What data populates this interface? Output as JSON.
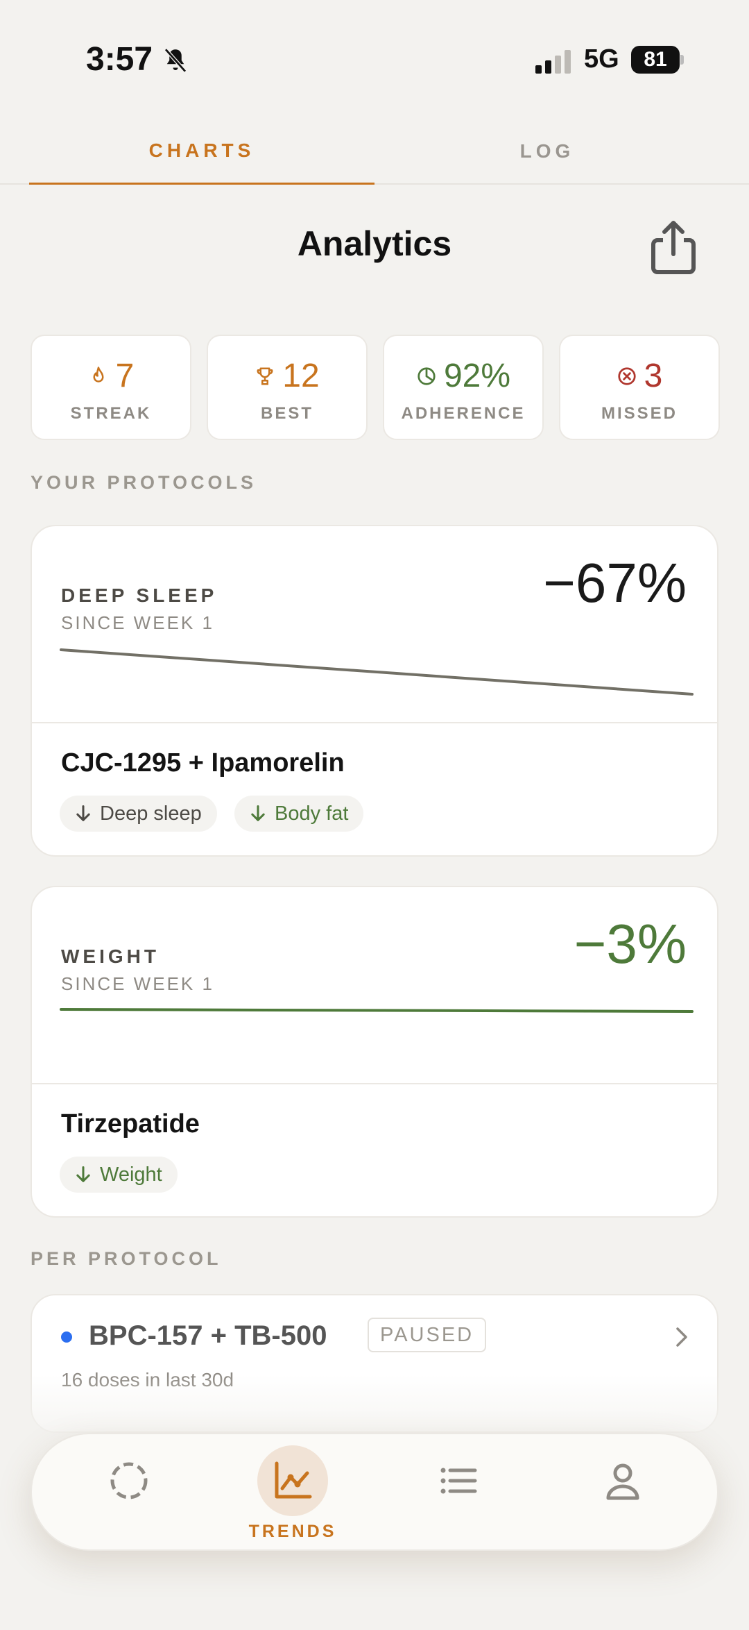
{
  "status": {
    "time": "3:57",
    "network": "5G",
    "battery": "81"
  },
  "tabs": [
    {
      "label": "CHARTS"
    },
    {
      "label": "LOG"
    }
  ],
  "header": {
    "title": "Analytics"
  },
  "stats": [
    {
      "value": "7",
      "label": "STREAK",
      "icon": "flame-icon",
      "color": "#c8741e"
    },
    {
      "value": "12",
      "label": "BEST",
      "icon": "trophy-icon",
      "color": "#c8741e"
    },
    {
      "value": "92%",
      "label": "ADHERENCE",
      "icon": "pie-icon",
      "color": "#4e7a3a"
    },
    {
      "value": "3",
      "label": "MISSED",
      "icon": "x-circle-icon",
      "color": "#b0372e"
    }
  ],
  "section_protocols": "YOUR PROTOCOLS",
  "protocol_cards": [
    {
      "metric": "DEEP SLEEP",
      "since": "SINCE WEEK 1",
      "change": "−67%",
      "name": "CJC-1295 + Ipamorelin",
      "tags": [
        {
          "label": "Deep sleep",
          "direction": "down",
          "color": "#4d4a45"
        },
        {
          "label": "Body fat",
          "direction": "down",
          "color": "#4e7a3a"
        }
      ]
    },
    {
      "metric": "WEIGHT",
      "since": "SINCE WEEK 1",
      "change": "−3%",
      "name": "Tirzepatide",
      "tags": [
        {
          "label": "Weight",
          "direction": "down",
          "color": "#4e7a3a"
        }
      ]
    }
  ],
  "section_per_protocol": "PER PROTOCOL",
  "per_protocol": [
    {
      "name": "BPC-157 + TB-500",
      "badge": "PAUSED",
      "sub": "16 doses in last 30d"
    }
  ],
  "nav": {
    "active_label": "TRENDS"
  },
  "colors": {
    "accent": "#c8741e",
    "green": "#4e7a3a",
    "red": "#b0372e",
    "blue_dot": "#2b6ef0"
  }
}
